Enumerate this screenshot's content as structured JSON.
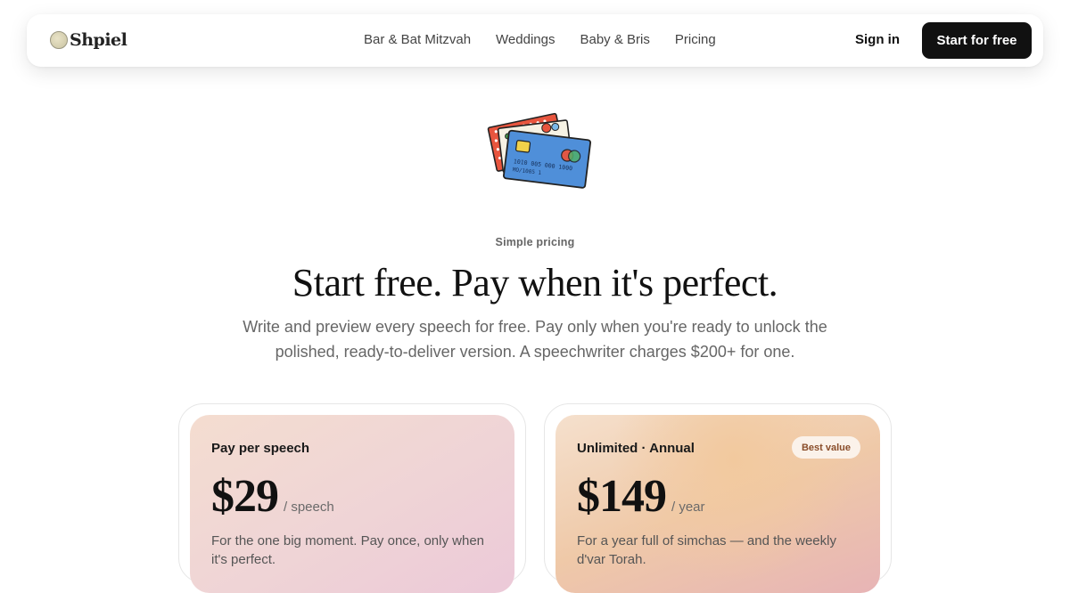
{
  "brand": {
    "name": "Shpiel",
    "logo_icon": "coin-icon"
  },
  "nav": {
    "links": [
      "Bar & Bat Mitzvah",
      "Weddings",
      "Baby & Bris",
      "Pricing"
    ],
    "sign_in": "Sign in",
    "cta": "Start for free"
  },
  "hero": {
    "illustration": "credit-cards-illustration",
    "card_number_line": "1010 005 000 1000",
    "card_expiry_line": "MO/1005 1",
    "eyebrow": "Simple pricing",
    "headline": "Start free. Pay when it's perfect.",
    "subtitle": "Write and preview every speech for free. Pay only when you're ready to unlock the polished, ready-to-deliver version. A speechwriter charges $200+ for one."
  },
  "plans": [
    {
      "name": "Pay per speech",
      "price": "$29",
      "unit": "/ speech",
      "description": "For the one big moment. Pay once, only when it's perfect."
    },
    {
      "name": "Unlimited · Annual",
      "badge": "Best value",
      "price": "$149",
      "unit": "/ year",
      "description": "For a year full of simchas — and the weekly d'var Torah."
    }
  ],
  "colors": {
    "primary": "#111111",
    "card1_gradient": "#f4ddd0",
    "card2_gradient": "#efc9a8",
    "badge_text": "#8a4d2a"
  }
}
